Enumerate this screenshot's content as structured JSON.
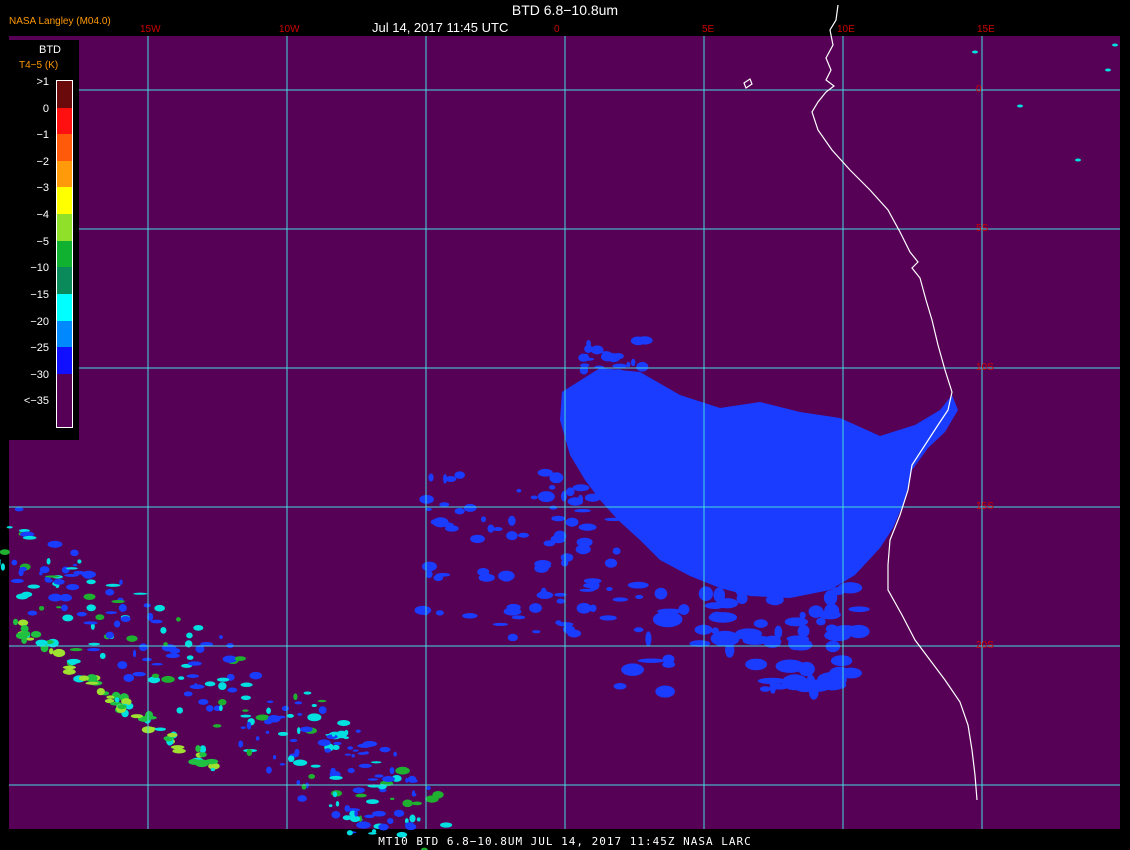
{
  "header": {
    "title": "BTD 6.8−10.8um",
    "timestamp": "Jul 14, 2017 11:45 UTC"
  },
  "credit": "NASA Langley (M04.0)",
  "legend": {
    "title": "BTD",
    "subtitle": "T4−5 (K)",
    "bins": [
      {
        "label": ">1",
        "color": "#6b0a0a"
      },
      {
        "label": "0",
        "color": "#ff1010"
      },
      {
        "label": "−1",
        "color": "#ff5a0a"
      },
      {
        "label": "−2",
        "color": "#ff9a0a"
      },
      {
        "label": "−3",
        "color": "#ffff00"
      },
      {
        "label": "−4",
        "color": "#90e02a"
      },
      {
        "label": "−5",
        "color": "#10b030"
      },
      {
        "label": "−10",
        "color": "#0a8a5a"
      },
      {
        "label": "−15",
        "color": "#00ffff"
      },
      {
        "label": "−20",
        "color": "#0088ff"
      },
      {
        "label": "−25",
        "color": "#1010ff"
      },
      {
        "label": "−30",
        "color": "#560056"
      },
      {
        "label": "<−35",
        "color": ""
      }
    ]
  },
  "map": {
    "background_color": "#560056",
    "grid_color": "#44dddd",
    "coast_color": "#ffffff",
    "cloud_color": "#1a3cff",
    "lon_labels": [
      "15W",
      "10W",
      "0",
      "5E",
      "10E",
      "15E"
    ],
    "lat_labels": [
      "0",
      "5S",
      "10S",
      "15S",
      "20S"
    ]
  },
  "footer": "MT10  BTD 6.8−10.8UM   JUL 14, 2017 11:45Z   NASA LARC"
}
